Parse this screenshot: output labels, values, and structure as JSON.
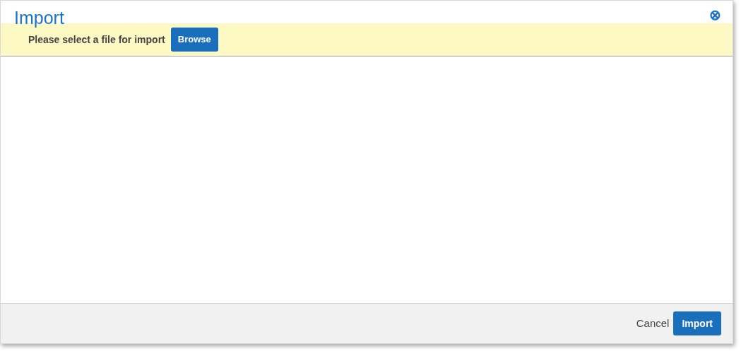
{
  "dialog": {
    "title": "Import",
    "close": "⊗"
  },
  "file_bar": {
    "prompt": "Please select a file for import",
    "button": "Browse"
  },
  "footer": {
    "buttons": [
      {
        "label": "Cancel",
        "kind": "link"
      },
      {
        "label": "Import",
        "kind": "primary"
      }
    ]
  }
}
